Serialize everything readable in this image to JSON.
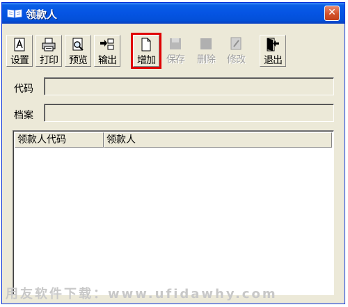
{
  "window": {
    "title": "领款人",
    "close_glyph": "✕"
  },
  "toolbar": {
    "buttons": [
      {
        "label": "设置",
        "icon": "setup-icon",
        "enabled": true
      },
      {
        "label": "打印",
        "icon": "printer-icon",
        "enabled": true
      },
      {
        "label": "预览",
        "icon": "preview-icon",
        "enabled": true
      },
      {
        "label": "输出",
        "icon": "export-icon",
        "enabled": true
      },
      {
        "label": "增加",
        "icon": "new-document-icon",
        "enabled": true,
        "highlighted": true
      },
      {
        "label": "保存",
        "icon": "save-icon",
        "enabled": false
      },
      {
        "label": "删除",
        "icon": "delete-icon",
        "enabled": false
      },
      {
        "label": "修改",
        "icon": "edit-icon",
        "enabled": false
      },
      {
        "label": "退出",
        "icon": "exit-icon",
        "enabled": true
      }
    ]
  },
  "form": {
    "code_label": "代码",
    "code_value": "",
    "file_label": "档案",
    "file_value": ""
  },
  "list": {
    "columns": [
      "领款人代码",
      "领款人"
    ],
    "rows": []
  },
  "watermark": "用友软件下载：www.ufidawhy.com",
  "colors": {
    "titlebar": "#0554e3",
    "dialog_bg": "#ece9d8",
    "highlight": "#e00000",
    "close_button": "#d3532c"
  }
}
